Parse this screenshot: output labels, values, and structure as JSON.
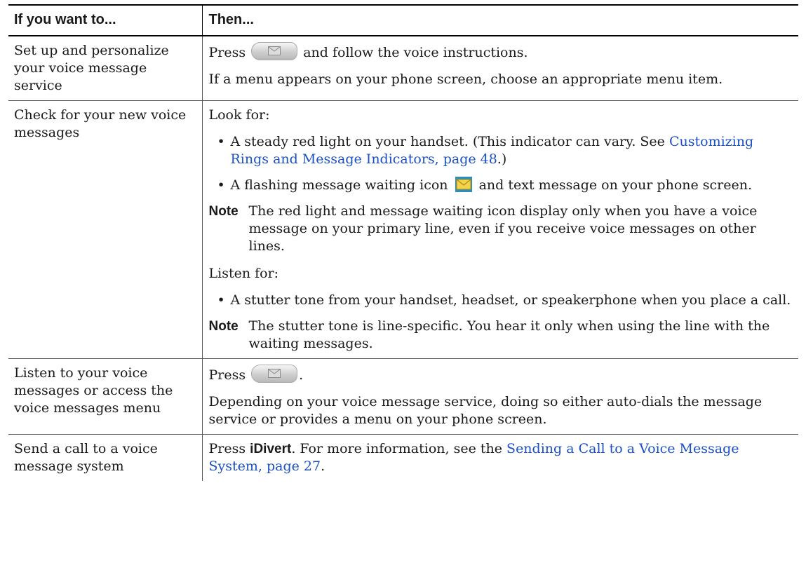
{
  "table": {
    "header": {
      "col1": "If you want to...",
      "col2": "Then..."
    },
    "row1": {
      "task": "Set up and personalize your voice message service",
      "p1_pre": "Press",
      "p1_post": "and follow the voice instructions.",
      "p2": "If a menu appears on your phone screen, choose an appropriate menu item."
    },
    "row2": {
      "task": "Check for your new voice messages",
      "look_for": "Look for:",
      "bullet1_pre": "A steady red light on your handset. (This indicator can vary. See",
      "bullet1_link": "Customizing Rings and Message Indicators, page 48",
      "bullet1_post": ".)",
      "bullet2_pre": "A flashing message waiting icon",
      "bullet2_post": "and text message on your phone screen.",
      "note_label": "Note",
      "note1": "The red light and message waiting icon display only when you have a voice message on your primary line, even if you receive voice messages on other lines.",
      "listen_for": "Listen for:",
      "bullet3": "A stutter tone from your handset, headset, or speakerphone when you place a call.",
      "note2": "The stutter tone is line-specific. You hear it only when using the line with the waiting messages."
    },
    "row3": {
      "task": "Listen to your voice messages or access the voice messages menu",
      "p1_pre": "Press",
      "p1_post": ".",
      "p2": "Depending on your voice message service, doing so either auto-dials the message service or provides a menu on your phone screen."
    },
    "row4": {
      "task": "Send a call to a voice message system",
      "pre": "Press",
      "softkey": "iDivert",
      "mid": ". For more information, see the",
      "link": "Sending a Call to a Voice Message System, page 27",
      "post": "."
    }
  },
  "icons": {
    "messages_button": "messages-button-icon",
    "message_waiting": "message-waiting-envelope-icon",
    "envelope_fill": "#f4d34c",
    "link_color": "#1a4fc9"
  }
}
